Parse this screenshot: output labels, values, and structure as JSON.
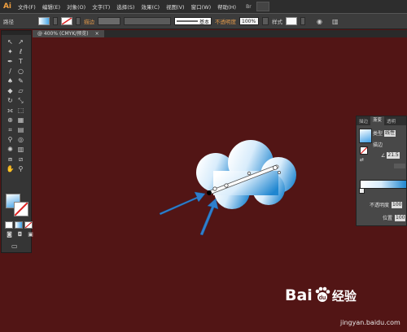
{
  "app": {
    "logo": "Ai"
  },
  "menubar": {
    "items": [
      "文件(F)",
      "编辑(E)",
      "对象(O)",
      "文字(T)",
      "选择(S)",
      "效果(C)",
      "视图(V)",
      "窗口(W)",
      "帮助(H)"
    ],
    "bridge_label": "Br"
  },
  "control_bar": {
    "mode_label": "路径",
    "stroke_label": "描边",
    "stroke_profile": "基本",
    "opacity_label": "不透明度",
    "opacity_value": "100%",
    "style_label": "样式"
  },
  "document_tab": {
    "title": "@ 400% (CMYK/预览)",
    "close": "×"
  },
  "gradient_panel": {
    "tabs": [
      "描边",
      "渐变",
      "透明"
    ],
    "type_label": "类型",
    "type_value": "线性",
    "stroke_label": "描边",
    "angle_value": "21.5",
    "opacity_label": "不透明度",
    "opacity_value": "100",
    "location_label": "位置",
    "location_value": "100"
  },
  "watermark": {
    "brand": "Bai",
    "brand_tail": "du",
    "product": "经验",
    "url": "jingyan.baidu.com"
  },
  "colors": {
    "canvas": "#521515",
    "annotation_arrow": "#2f7fcc",
    "cloud_edge": "#1f86d0",
    "accent": "#e49a4a"
  }
}
